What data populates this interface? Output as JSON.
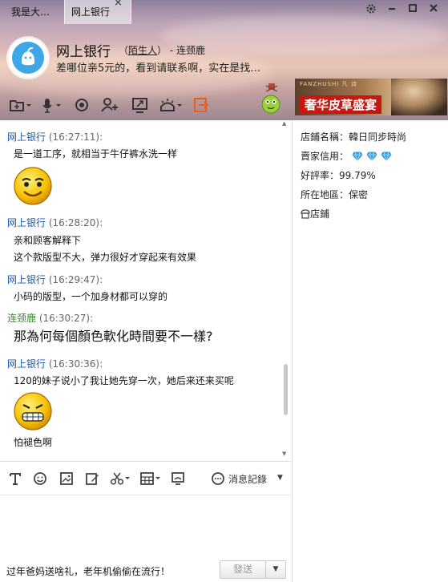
{
  "tabs": {
    "tab1": "我是大…",
    "tab2": "网上银行",
    "close_glyph": "×"
  },
  "contact": {
    "name": "网上银行",
    "relation_open": "（",
    "relation_label": "陌生人",
    "relation_close": "）",
    "relation_suffix": " - 连颈鹿",
    "status": "差哪位亲5元的，看到请联系啊，实在是找…"
  },
  "toolbar_icons": [
    "folder-share-icon",
    "microphone-icon",
    "video-icon",
    "add-contact-icon",
    "screen-share-icon",
    "remote-assist-icon",
    "exit-icon"
  ],
  "ad": {
    "brand": "FANZHUSHI 凡 诗",
    "label": "奢华皮草盛宴"
  },
  "messages": [
    {
      "sender": "网上银行",
      "time": "(16:27:11):",
      "lines": [
        "是一道工序，就相当于牛仔裤水洗一样"
      ],
      "emoji": "smile-emoji"
    },
    {
      "sender": "网上银行",
      "time": "(16:28:20):",
      "lines": [
        "亲和顾客解释下",
        "这个款版型不大，弹力很好才穿起来有效果"
      ]
    },
    {
      "sender": "网上银行",
      "time": "(16:29:47):",
      "lines": [
        "小码的版型，一个加身材都可以穿的"
      ]
    },
    {
      "sender": "连颈鹿",
      "time": "(16:30:27):",
      "lines": [
        "那為何每個顏色軟化時間要不一樣?"
      ]
    },
    {
      "sender": "网上银行",
      "time": "(16:30:36):",
      "lines": [
        "120的妹子说小了我让她先穿一次，她后来还来买呢",
        "怕褪色啊"
      ],
      "emoji": "grin-emoji"
    }
  ],
  "input_toolbar": {
    "icons": [
      "font-icon",
      "emoji-icon",
      "image-icon",
      "edit-icon",
      "scissors-icon",
      "calculator-icon",
      "screen-icon"
    ],
    "history_label": "消息記錄"
  },
  "bottom": {
    "link": "过年爸妈送啥礼，老年机偷偷在流行！",
    "send_label": "發送"
  },
  "shop": {
    "name_label": "店鋪名稱：",
    "name_value": "韓日同步時尚",
    "credit_label": "賣家信用：",
    "credit_diamonds": 3,
    "rating_label": "好評率：",
    "rating_value": "99.79%",
    "region_label": "所在地區：",
    "region_value": "保密",
    "store_link": "店鋪"
  },
  "colors": {
    "sender_other": "#1e5aa8",
    "sender_self": "#3a8a2e",
    "avatar": "#3da7e8",
    "ad_label_bg": "#c61810"
  }
}
